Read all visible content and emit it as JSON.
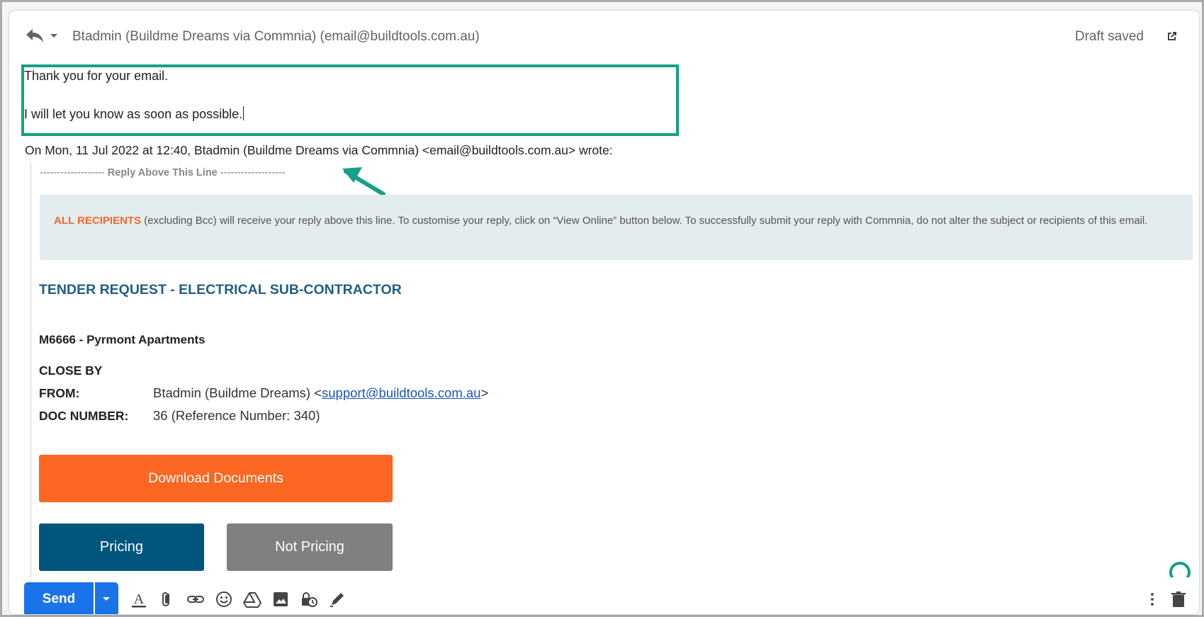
{
  "header": {
    "title": "Btadmin (Buildme Dreams via Commnia) (email@buildtools.com.au)",
    "status": "Draft saved"
  },
  "reply": {
    "line1": "Thank you for your email.",
    "line2": "I will let you know as soon as possible."
  },
  "quote": {
    "attribution": "On Mon, 11 Jul 2022 at 12:40, Btadmin (Buildme Dreams via Commnia) <email@buildtools.com.au> wrote:",
    "divider_left": "-------------------",
    "divider_label": "Reply Above This Line",
    "divider_right": "-------------------",
    "notice_highlight": "ALL RECIPIENTS",
    "notice_text": " (excluding Bcc) will receive your reply above this line. To customise your reply, click on “View Online” button below. To successfully submit your reply with Commnia, do not alter the subject or recipients of this email.",
    "tender_title": "TENDER REQUEST - ELECTRICAL SUB-CONTRACTOR",
    "project": "M6666 - Pyrmont Apartments",
    "close_by_label": "CLOSE BY",
    "from_label": "FROM:",
    "from_value": "Btadmin  (Buildme Dreams)  <",
    "from_email": "support@buildtools.com.au",
    "from_value_end": ">",
    "doc_label": "DOC NUMBER:",
    "doc_value": "36 (Reference Number: 340)",
    "download_label": "Download Documents",
    "pricing_label": "Pricing",
    "not_pricing_label": "Not Pricing"
  },
  "toolbar": {
    "send_label": "Send"
  },
  "colors": {
    "highlight_border": "#16a085",
    "download": "#fc6722",
    "pricing": "#00557d",
    "not_pricing": "#808080",
    "send": "#1a73e8",
    "tender_title": "#225d84"
  },
  "icons": [
    "reply-icon",
    "popout-icon",
    "formatting-icon",
    "attach-icon",
    "link-icon",
    "emoji-icon",
    "drive-icon",
    "photo-icon",
    "confidential-icon",
    "signature-icon",
    "more-options-icon",
    "trash-icon"
  ]
}
